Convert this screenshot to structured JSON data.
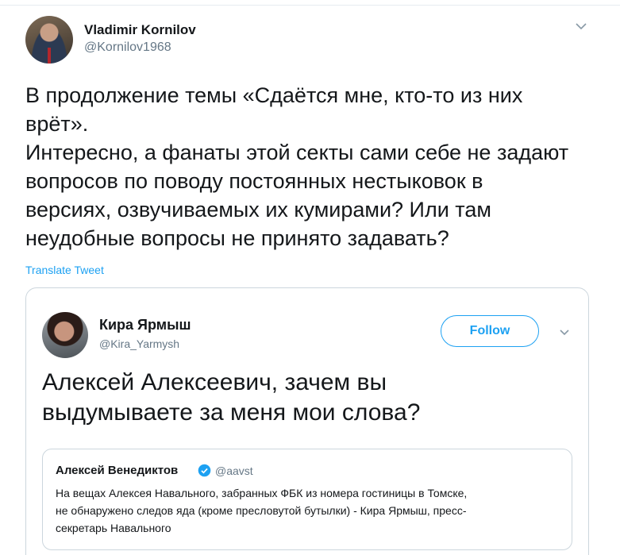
{
  "tweet": {
    "author_name": "Vladimir Kornilov",
    "author_handle": "@Kornilov1968",
    "text_lines": [
      "В продолжение темы «Сдаётся мне, кто-то из них",
      "врёт».",
      "Интересно, а фанаты этой секты сами себе не задают",
      "вопросов по поводу постоянных нестыковок в",
      "версиях, озвучиваемых их кумирами? Или там",
      "неудобные вопросы не принято задавать?"
    ],
    "translate_label": "Translate Tweet"
  },
  "embedded": {
    "author_name": "Кира Ярмыш",
    "author_handle": "@Kira_Yarmysh",
    "follow_label": "Follow",
    "text_lines": [
      "Алексей Алексеевич, зачем вы",
      "выдумываете за меня мои слова?"
    ],
    "quoted": {
      "author_name": "Алексей Венедиктов",
      "author_handle": "@aavst",
      "text_lines": [
        "На вещах Алексея Навального, забранных ФБК из номера гостиницы в Томске,",
        "не обнаружено следов яда (кроме пресловутой бутылки) - Кира Ярмыш, пресс-",
        "секретарь Навального"
      ]
    }
  },
  "icons": {
    "caret": "chevron-down-icon",
    "verified": "verified-badge-icon"
  },
  "colors": {
    "accent": "#1da1f2",
    "secondary_text": "#657786",
    "border": "#ccd6dd"
  }
}
